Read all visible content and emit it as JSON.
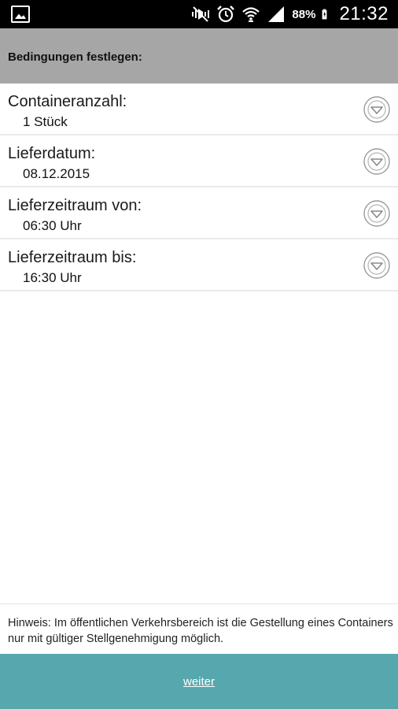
{
  "statusbar": {
    "icons": [
      "image-notification-icon",
      "mute-icon",
      "alarm-icon",
      "wifi-icon",
      "signal-icon",
      "battery-icon"
    ],
    "battery": "88%",
    "time": "21:32"
  },
  "header": {
    "title": "Bedingungen festlegen:"
  },
  "conditions": [
    {
      "label": "Containeranzahl:",
      "value": "1 Stück"
    },
    {
      "label": "Lieferdatum:",
      "value": "08.12.2015"
    },
    {
      "label": "Lieferzeitraum von:",
      "value": "06:30 Uhr"
    },
    {
      "label": "Lieferzeitraum bis:",
      "value": "16:30 Uhr"
    }
  ],
  "note": {
    "text": "Hinweis: Im öffentlichen Verkehrsbereich ist die Gestellung eines Containers nur mit gültiger Stellgenehmigung möglich."
  },
  "footer": {
    "button_label": "weiter"
  },
  "colors": {
    "header_bg": "#a6a6a6",
    "accent": "#57a8ae",
    "divider": "#e7ecec"
  }
}
